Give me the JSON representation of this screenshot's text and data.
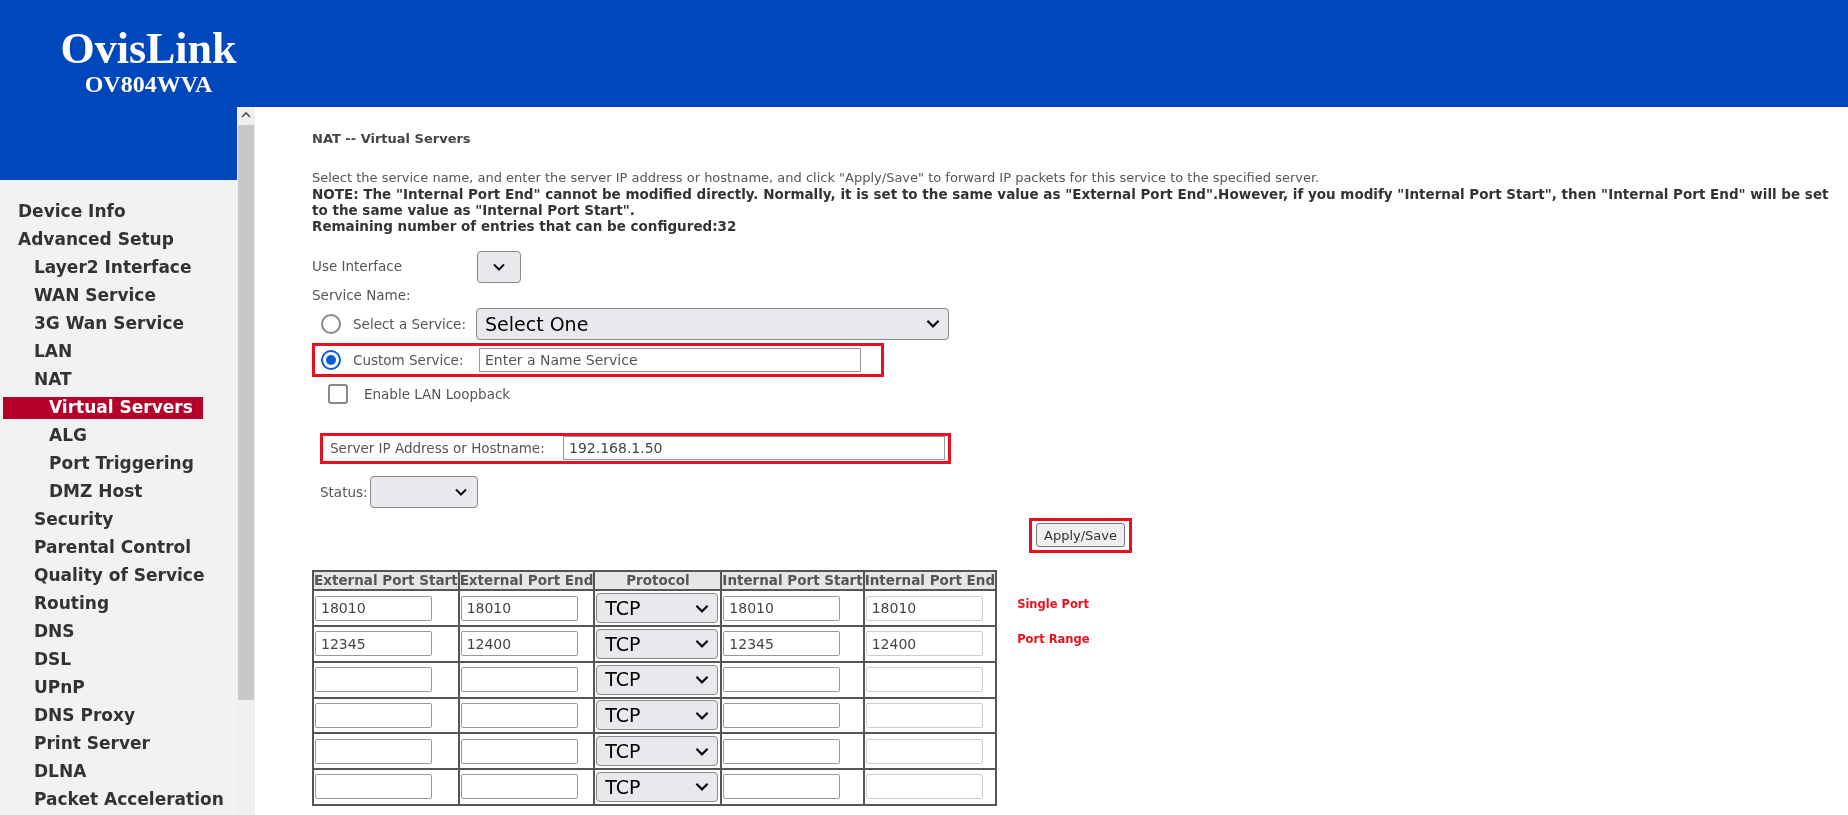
{
  "header": {
    "brand": "OvisLink",
    "model": "OV804WVA"
  },
  "sidebar": {
    "items": [
      {
        "label": "Device Info",
        "selected": false
      },
      {
        "label": "Advanced Setup",
        "selected": false,
        "children": [
          {
            "label": "Layer2 Interface",
            "selected": false
          },
          {
            "label": "WAN Service",
            "selected": false
          },
          {
            "label": "3G Wan Service",
            "selected": false
          },
          {
            "label": "LAN",
            "selected": false
          },
          {
            "label": "NAT",
            "selected": false,
            "children": [
              {
                "label": "Virtual Servers",
                "selected": true
              },
              {
                "label": "ALG",
                "selected": false
              },
              {
                "label": "Port Triggering",
                "selected": false
              },
              {
                "label": "DMZ Host",
                "selected": false
              }
            ]
          },
          {
            "label": "Security",
            "selected": false
          },
          {
            "label": "Parental Control",
            "selected": false
          },
          {
            "label": "Quality of Service",
            "selected": false
          },
          {
            "label": "Routing",
            "selected": false
          },
          {
            "label": "DNS",
            "selected": false
          },
          {
            "label": "DSL",
            "selected": false
          },
          {
            "label": "UPnP",
            "selected": false
          },
          {
            "label": "DNS Proxy",
            "selected": false
          },
          {
            "label": "Print Server",
            "selected": false
          },
          {
            "label": "DLNA",
            "selected": false
          },
          {
            "label": "Packet Acceleration",
            "selected": false
          }
        ]
      }
    ]
  },
  "page": {
    "title": "NAT -- Virtual Servers",
    "intro": "Select the service name, and enter the server IP address or hostname, and click \"Apply/Save\" to forward IP packets for this service to the specified server.",
    "note": "NOTE: The \"Internal Port End\" cannot be modified directly. Normally, it is set to the same value as \"External Port End\".However, if you modify \"Internal Port Start\", then \"Internal Port End\" will be set to the same value as \"Internal Port Start\".",
    "remaining": "Remaining number of entries that can be configured:32"
  },
  "form": {
    "use_interface_label": "Use Interface",
    "service_name_label": "Service Name:",
    "service_options": [
      {
        "label": "Select a Service:",
        "selected": false,
        "kind": "select",
        "value": "Select One"
      },
      {
        "label": "Custom Service:",
        "selected": true,
        "kind": "input",
        "placeholder": "Enter a Name Service"
      }
    ],
    "loopback": {
      "label": "Enable LAN Loopback",
      "checked": false
    },
    "server_ip": {
      "label": "Server IP Address or Hostname:",
      "value": "192.168.1.50"
    },
    "status_label": "Status:",
    "apply_button": "Apply/Save"
  },
  "table": {
    "columns": [
      "External Port Start",
      "External Port End",
      "Protocol",
      "Internal Port Start",
      "Internal Port End"
    ],
    "rows": [
      {
        "ext_start": "18010",
        "ext_end": "18010",
        "protocol": "TCP",
        "int_start": "18010",
        "int_end": "18010",
        "note": "Single Port"
      },
      {
        "ext_start": "12345",
        "ext_end": "12400",
        "protocol": "TCP",
        "int_start": "12345",
        "int_end": "12400",
        "note": "Port Range"
      },
      {
        "protocol": "TCP"
      },
      {
        "protocol": "TCP"
      },
      {
        "protocol": "TCP"
      },
      {
        "protocol": "TCP"
      }
    ]
  }
}
